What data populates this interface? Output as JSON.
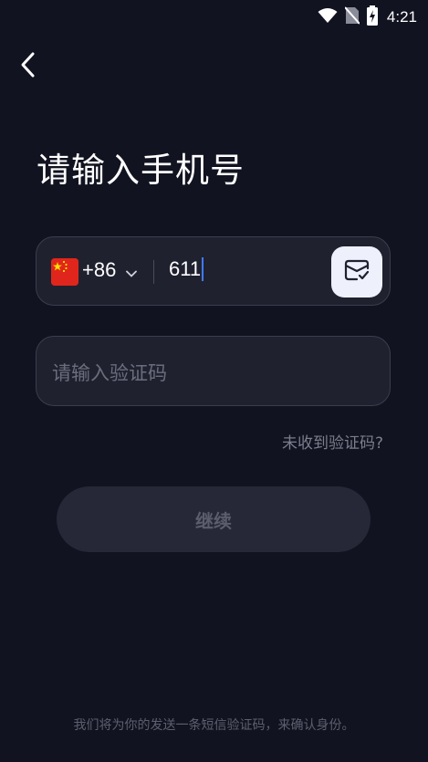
{
  "status_bar": {
    "time": "4:21",
    "icons": [
      "wifi-icon",
      "no-sim-icon",
      "battery-charging-icon"
    ]
  },
  "header": {
    "back_icon": "chevron-left-icon",
    "title": "请输入手机号"
  },
  "phone_field": {
    "flag_icon": "china-flag-icon",
    "dial_code": "+86",
    "value": "611",
    "paste_icon": "sms-paste-icon"
  },
  "code_field": {
    "placeholder": "请输入验证码"
  },
  "resend_link": "未收到验证码?",
  "continue_button": "继续",
  "footer_note": "我们将为你的发送一条短信验证码，来确认身份。",
  "colors": {
    "background": "#111320",
    "field_bg": "#20212f",
    "field_border": "#3b3d4f",
    "button_bg": "#262838",
    "caret": "#3d7bff"
  }
}
